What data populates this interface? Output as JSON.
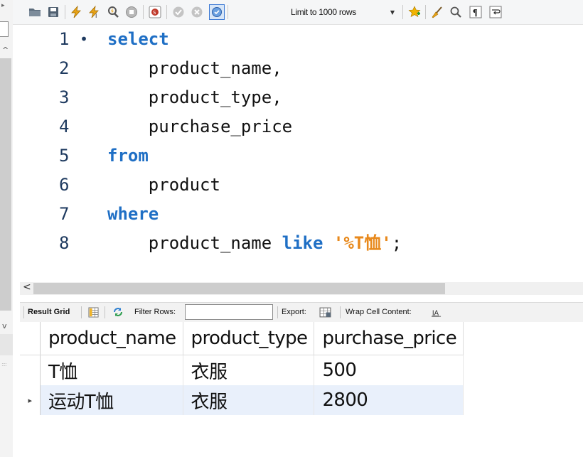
{
  "toolbar": {
    "limit_label": "Limit to 1000 rows",
    "colors": {
      "execute": "#e8a317",
      "stop": "#9e9e9e",
      "toggle_active": "#3a78d4"
    }
  },
  "editor": {
    "lines": [
      {
        "num": "1",
        "marker": "•",
        "tokens": [
          {
            "text": "select",
            "kind": "kw"
          }
        ]
      },
      {
        "num": "2",
        "tokens": [
          {
            "text": "    product_name,",
            "kind": "plain"
          }
        ]
      },
      {
        "num": "3",
        "tokens": [
          {
            "text": "    product_type,",
            "kind": "plain"
          }
        ]
      },
      {
        "num": "4",
        "tokens": [
          {
            "text": "    purchase_price",
            "kind": "plain"
          }
        ]
      },
      {
        "num": "5",
        "tokens": [
          {
            "text": "from",
            "kind": "kw"
          }
        ]
      },
      {
        "num": "6",
        "tokens": [
          {
            "text": "    product",
            "kind": "plain"
          }
        ]
      },
      {
        "num": "7",
        "tokens": [
          {
            "text": "where",
            "kind": "kw"
          }
        ]
      },
      {
        "num": "8",
        "tokens": [
          {
            "text": "    product_name ",
            "kind": "plain"
          },
          {
            "text": "like",
            "kind": "kw"
          },
          {
            "text": " ",
            "kind": "plain"
          },
          {
            "text": "'%T恤'",
            "kind": "str"
          },
          {
            "text": ";",
            "kind": "plain"
          }
        ]
      }
    ],
    "colors": {
      "keyword": "#1f6fc5",
      "string": "#e8891c",
      "line_number": "#1e3a5f"
    }
  },
  "result_toolbar": {
    "result_grid_label": "Result Grid",
    "filter_label": "Filter Rows:",
    "filter_value": "",
    "export_label": "Export:",
    "wrap_label": "Wrap Cell Content:"
  },
  "grid": {
    "columns": [
      "product_name",
      "product_type",
      "purchase_price"
    ],
    "rows": [
      {
        "selected": false,
        "cells": [
          "T恤",
          "衣服",
          "500"
        ]
      },
      {
        "selected": true,
        "cells": [
          "运动T恤",
          "衣服",
          "2800"
        ]
      }
    ],
    "selected_row_color": "#e9f0fb"
  }
}
